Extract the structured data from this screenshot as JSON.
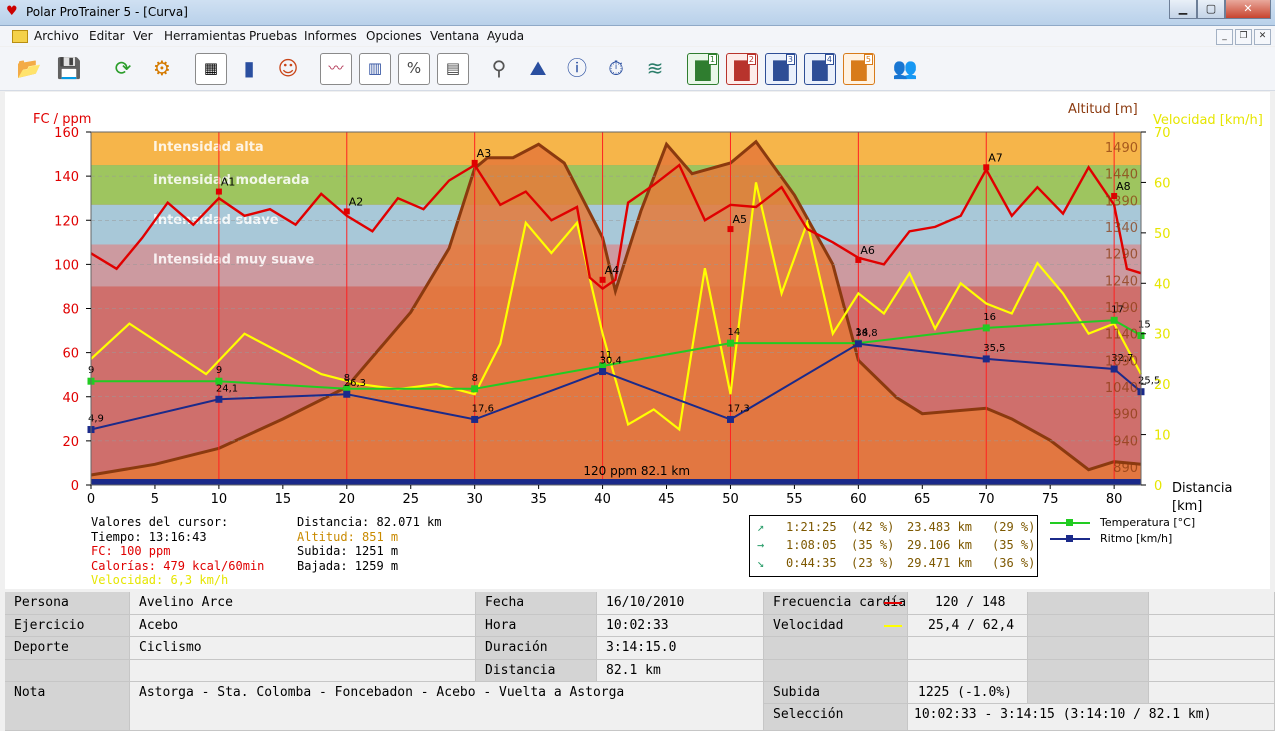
{
  "window": {
    "title": "Polar ProTrainer 5 - [Curva]"
  },
  "menu": {
    "items": [
      "Archivo",
      "Editar",
      "Ver",
      "Herramientas",
      "Pruebas",
      "Informes",
      "Opciones",
      "Ventana",
      "Ayuda"
    ]
  },
  "toolbar": {
    "buttons": [
      "open-folder-icon",
      "save-icon",
      "sync-icon",
      "settings-gear-icon",
      "calendar-icon",
      "book-icon",
      "person-speech-icon",
      "line-chart-icon",
      "bar-chart-icon",
      "percent-chart-icon",
      "table-icon",
      "zoom-1-1-icon",
      "altitude-info-icon",
      "info-circle-icon",
      "stopwatch-icon",
      "multi-line-icon",
      "chart-1-icon",
      "chart-2-icon",
      "chart-3-icon",
      "chart-4-icon",
      "chart-5-icon",
      "users-icon"
    ]
  },
  "chart_data": {
    "type": "line",
    "ylabel_left": "FC / ppm",
    "ylabel_right_1": "Altitud [m]",
    "ylabel_right_2": "Velocidad [km/h]",
    "xlabel": "Distancia [km]",
    "xlim": [
      0,
      82.1
    ],
    "ylim_hr": [
      0,
      160
    ],
    "ylim_speed": [
      0,
      70
    ],
    "ylim_altitude": [
      851,
      1490
    ],
    "x_ticks": [
      "0",
      "5",
      "10",
      "15",
      "20",
      "25",
      "30",
      "35",
      "40",
      "45",
      "50",
      "55",
      "60",
      "65",
      "70",
      "75",
      "80"
    ],
    "hr_ticks": [
      "0",
      "20",
      "40",
      "60",
      "80",
      "100",
      "120",
      "140",
      "160"
    ],
    "speed_ticks": [
      "0",
      "10",
      "20",
      "30",
      "40",
      "50",
      "60",
      "70"
    ],
    "altitude_ticks": [
      "890",
      "940",
      "990",
      "1040",
      "1090",
      "1140",
      "1190",
      "1240",
      "1290",
      "1340",
      "1390",
      "1440",
      "1490"
    ],
    "zones": [
      {
        "label": "Intensidad alta",
        "from": 145,
        "to": 160,
        "color": "#f6b54a"
      },
      {
        "label": "Intensidad moderada",
        "from": 127,
        "to": 145,
        "color": "#9ec55f"
      },
      {
        "label": "Intensidad suave",
        "from": 109,
        "to": 127,
        "color": "#a8c8d8"
      },
      {
        "label": "Intensidad muy suave",
        "from": 90,
        "to": 109,
        "color": "#cc9aa0"
      }
    ],
    "hr_mean_label": "120 ppm 82.1 km",
    "laps": [
      {
        "name": "A1",
        "x": 10,
        "hr": 133
      },
      {
        "name": "A2",
        "x": 20,
        "hr": 124
      },
      {
        "name": "A3",
        "x": 30,
        "hr": 146
      },
      {
        "name": "A4",
        "x": 40,
        "hr": 93
      },
      {
        "name": "A5",
        "x": 50,
        "hr": 116
      },
      {
        "name": "A6",
        "x": 60,
        "hr": 102
      },
      {
        "name": "A7",
        "x": 70,
        "hr": 144
      },
      {
        "name": "A8",
        "x": 80,
        "hr": 131
      }
    ],
    "series": [
      {
        "name": "Temperatura [°C]",
        "color": "#22cc22",
        "x": [
          0,
          10,
          20,
          30,
          40,
          50,
          60,
          70,
          80,
          82.1
        ],
        "values": [
          9,
          9,
          8,
          8,
          11,
          14,
          14,
          16,
          17,
          15
        ],
        "labels": [
          "9",
          "9",
          "8",
          "8",
          "11",
          "14",
          "14",
          "16",
          "17",
          "15"
        ]
      },
      {
        "name": "Ritmo [km/h]",
        "color": "#1b2a8a",
        "x": [
          0,
          10,
          20,
          30,
          40,
          50,
          60,
          70,
          80,
          82.1
        ],
        "values": [
          11,
          17,
          18,
          13,
          22.5,
          13,
          28,
          25,
          23,
          18.5
        ],
        "labels": [
          "4,9",
          "24,1",
          "26,3",
          "17,6",
          "30,4",
          "17,3",
          "38,8",
          "35,5",
          "32,7",
          "25,5"
        ]
      },
      {
        "name": "Altitud [m]",
        "color": "#8b3a0f",
        "x": [
          0,
          5,
          10,
          15,
          20,
          25,
          28,
          30,
          31,
          33,
          35,
          37,
          40,
          41,
          43,
          45,
          47,
          50,
          52,
          55,
          58,
          60,
          63,
          65,
          70,
          72,
          75,
          78,
          80,
          82.1
        ],
        "values": [
          875,
          895,
          925,
          980,
          1040,
          1180,
          1300,
          1450,
          1470,
          1470,
          1495,
          1460,
          1320,
          1220,
          1370,
          1495,
          1440,
          1460,
          1500,
          1400,
          1270,
          1090,
          1020,
          990,
          1000,
          980,
          940,
          885,
          900,
          895
        ]
      },
      {
        "name": "FC",
        "color": "#e00000",
        "x": [
          0,
          2,
          4,
          6,
          8,
          10,
          12,
          14,
          16,
          18,
          20,
          22,
          24,
          26,
          28,
          30,
          32,
          34,
          36,
          38,
          39,
          40,
          41,
          42,
          44,
          46,
          48,
          50,
          52,
          54,
          56,
          58,
          60,
          62,
          64,
          66,
          68,
          70,
          72,
          74,
          76,
          78,
          80,
          81,
          82.1
        ],
        "values": [
          105,
          98,
          112,
          128,
          118,
          130,
          122,
          125,
          118,
          132,
          122,
          115,
          130,
          125,
          138,
          145,
          127,
          133,
          120,
          126,
          94,
          89,
          93,
          128,
          136,
          145,
          120,
          127,
          126,
          135,
          116,
          110,
          103,
          100,
          115,
          117,
          122,
          143,
          122,
          135,
          123,
          144,
          127,
          98,
          96
        ]
      },
      {
        "name": "Velocidad",
        "color": "#ffff00",
        "x": [
          0,
          3,
          6,
          9,
          12,
          15,
          18,
          21,
          24,
          27,
          30,
          32,
          34,
          36,
          38,
          40,
          42,
          44,
          46,
          48,
          50,
          52,
          54,
          56,
          58,
          60,
          62,
          64,
          66,
          68,
          70,
          72,
          74,
          76,
          78,
          80,
          82.1
        ],
        "values": [
          25,
          32,
          27,
          22,
          30,
          26,
          22,
          20,
          19,
          20,
          18,
          28,
          52,
          46,
          52,
          30,
          12,
          15,
          11,
          43,
          18,
          60,
          38,
          52,
          30,
          38,
          34,
          42,
          31,
          40,
          36,
          34,
          44,
          38,
          30,
          32,
          22
        ]
      }
    ]
  },
  "cursor_info": {
    "title": "Valores del cursor:",
    "time": "Tiempo: 13:16:43",
    "hr": "FC: 100 ppm",
    "calories": "Calorías: 479 kcal/60min",
    "speed": "Velocidad: 6,3 km/h"
  },
  "summary": {
    "distance": "Distancia: 82.071 km",
    "altitude": "Altitud: 851 m",
    "ascent": "Subida: 1251 m",
    "descent": "Bajada: 1259 m"
  },
  "zones_table": [
    {
      "icon": "↗",
      "time": "1:21:25",
      "pct1": "(42 %)",
      "dist": "23.483 km",
      "pct2": "(29 %)"
    },
    {
      "icon": "→",
      "time": "1:08:05",
      "pct1": "(35 %)",
      "dist": "29.106 km",
      "pct2": "(35 %)"
    },
    {
      "icon": "↘",
      "time": "0:44:35",
      "pct1": "(23 %)",
      "dist": "29.471 km",
      "pct2": "(36 %)"
    }
  ],
  "legend": [
    {
      "label": "Temperatura [°C]",
      "color": "#22cc22"
    },
    {
      "label": "Ritmo [km/h]",
      "color": "#1b2a8a"
    }
  ],
  "details": {
    "persona_label": "Persona",
    "persona": "Avelino  Arce",
    "ejercicio_label": "Ejercicio",
    "ejercicio": "Acebo",
    "deporte_label": "Deporte",
    "deporte": "Ciclismo",
    "nota_label": "Nota",
    "nota": "Astorga - Sta. Colomba - Foncebadon - Acebo - Vuelta a Astorga",
    "fecha_label": "Fecha",
    "fecha": "16/10/2010",
    "hora_label": "Hora",
    "hora": "10:02:33",
    "duracion_label": "Duración",
    "duracion": "3:14:15.0",
    "distancia_label": "Distancia",
    "distancia": "82.1 km",
    "fc_label": "Frecuencia cardíaca",
    "fc": "120 / 148",
    "vel_label": "Velocidad",
    "vel": "25,4 / 62,4",
    "subida_label": "Subida",
    "subida": "1225 (-1.0%)",
    "seleccion_label": "Selección",
    "seleccion": "10:02:33 - 3:14:15 (3:14:10 / 82.1 km)"
  }
}
